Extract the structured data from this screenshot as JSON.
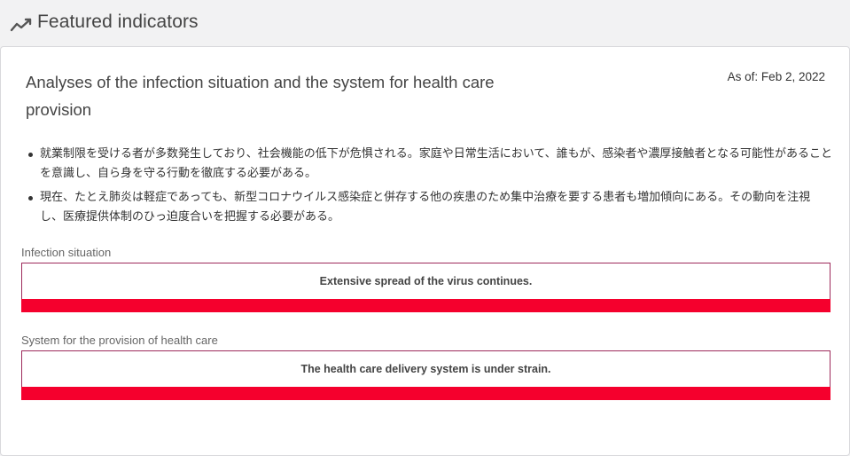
{
  "header": {
    "title": "Featured indicators",
    "icon": "trend-line-icon"
  },
  "card": {
    "title": "Analyses of the infection situation and the system for health care provision",
    "as_of": "As of: Feb 2, 2022",
    "bullets": [
      "就業制限を受ける者が多数発生しており、社会機能の低下が危惧される。家庭や日常生活において、誰もが、感染者や濃厚接触者となる可能性があることを意識し、自ら身を守る行動を徹底する必要がある。",
      "現在、たとえ肺炎は軽症であっても、新型コロナウイルス感染症と併存する他の疾患のため集中治療を要する患者も増加傾向にある。その動向を注視し、医療提供体制のひっ迫度合いを把握する必要がある。"
    ],
    "sections": [
      {
        "label": "Infection situation",
        "status": "Extensive spread of the virus continues.",
        "level_color": "#f5002d",
        "border_color": "#9d2a5b"
      },
      {
        "label": "System for the provision of health care",
        "status": "The health care delivery system is under strain.",
        "level_color": "#f5002d",
        "border_color": "#9d2a5b"
      }
    ]
  }
}
